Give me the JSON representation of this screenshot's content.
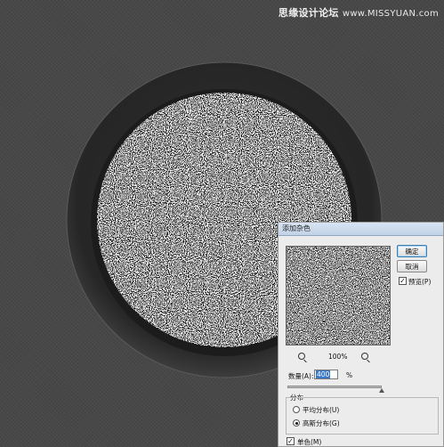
{
  "watermark": {
    "text": "思缘设计论坛",
    "site": "www.MISSYUAN.com"
  },
  "canvas": {
    "background_color": "#474747",
    "ring_color": "#2b2b2b",
    "noise_fill": "white-black noise"
  },
  "dialog": {
    "title": "添加杂色",
    "ok_label": "确定",
    "cancel_label": "取消",
    "preview_label": "预览(P)",
    "preview_checked": true,
    "zoom_level": "100%",
    "amount_label": "数量(A):",
    "amount_value": "400",
    "percent_symbol": "%",
    "amount_slider_fraction": 1.0,
    "distribution_title": "分布",
    "distribution_options": [
      {
        "label": "平均分布(U)",
        "selected": false
      },
      {
        "label": "高斯分布(G)",
        "selected": true
      }
    ],
    "monochromatic_label": "单色(M)",
    "monochromatic_checked": true
  }
}
